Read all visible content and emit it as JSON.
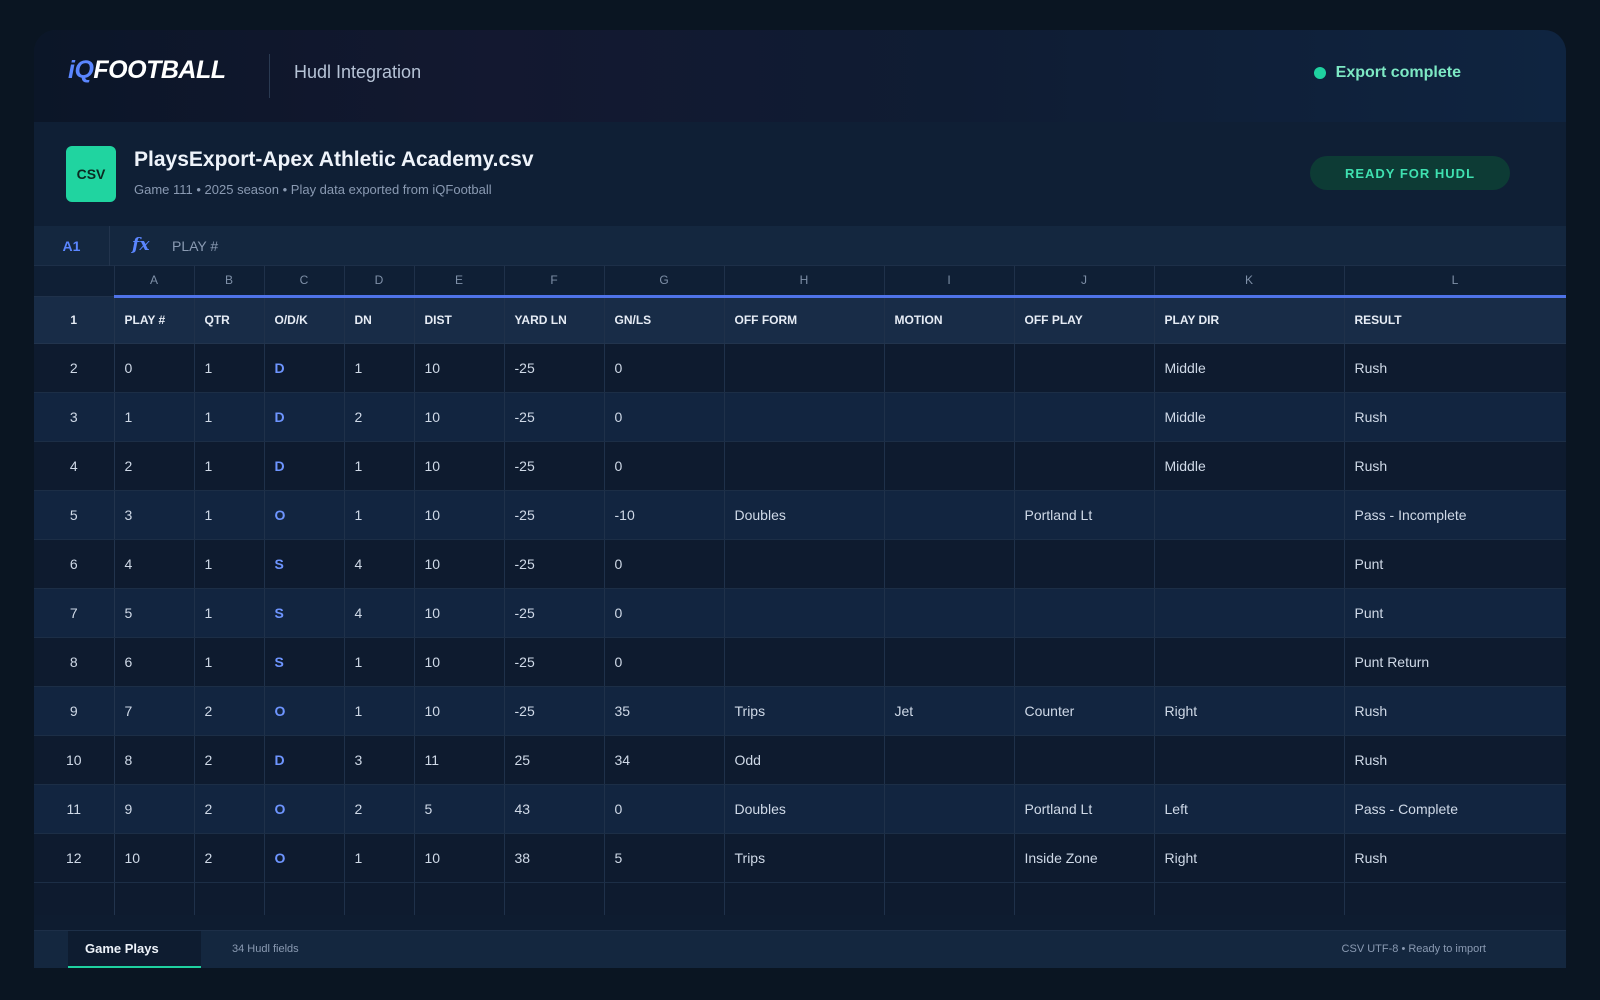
{
  "brand": {
    "logo_prefix": "iQ",
    "logo_suffix": "FOOTBALL",
    "app_title": "Hudl Integration"
  },
  "status": {
    "text": "Export complete",
    "color": "#1fd1a0"
  },
  "file": {
    "badge": "CSV",
    "name": "PlaysExport-Apex Athletic Academy.csv",
    "subtitle": "Game 111 • 2025 season • Play data exported from iQFootball",
    "action_label": "READY FOR HUDL"
  },
  "formula_bar": {
    "cell_ref": "A1",
    "fx_icon": "fx",
    "value": "PLAY #"
  },
  "columns": [
    "A",
    "B",
    "C",
    "D",
    "E",
    "F",
    "G",
    "H",
    "I",
    "J",
    "K",
    "L"
  ],
  "header_row": {
    "num": "1",
    "cells": [
      "PLAY #",
      "QTR",
      "O/D/K",
      "DN",
      "DIST",
      "YARD LN",
      "GN/LS",
      "OFF FORM",
      "MOTION",
      "OFF PLAY",
      "PLAY DIR",
      "RESULT"
    ]
  },
  "rows": [
    {
      "num": "2",
      "cells": [
        "0",
        "1",
        "D",
        "1",
        "10",
        "-25",
        "0",
        "",
        "",
        "",
        "Middle",
        "Rush"
      ]
    },
    {
      "num": "3",
      "cells": [
        "1",
        "1",
        "D",
        "2",
        "10",
        "-25",
        "0",
        "",
        "",
        "",
        "Middle",
        "Rush"
      ]
    },
    {
      "num": "4",
      "cells": [
        "2",
        "1",
        "D",
        "1",
        "10",
        "-25",
        "0",
        "",
        "",
        "",
        "Middle",
        "Rush"
      ]
    },
    {
      "num": "5",
      "cells": [
        "3",
        "1",
        "O",
        "1",
        "10",
        "-25",
        "-10",
        "Doubles",
        "",
        "Portland Lt",
        "",
        "Pass - Incomplete"
      ]
    },
    {
      "num": "6",
      "cells": [
        "4",
        "1",
        "S",
        "4",
        "10",
        "-25",
        "0",
        "",
        "",
        "",
        "",
        "Punt"
      ]
    },
    {
      "num": "7",
      "cells": [
        "5",
        "1",
        "S",
        "4",
        "10",
        "-25",
        "0",
        "",
        "",
        "",
        "",
        "Punt"
      ]
    },
    {
      "num": "8",
      "cells": [
        "6",
        "1",
        "S",
        "1",
        "10",
        "-25",
        "0",
        "",
        "",
        "",
        "",
        "Punt Return"
      ]
    },
    {
      "num": "9",
      "cells": [
        "7",
        "2",
        "O",
        "1",
        "10",
        "-25",
        "35",
        "Trips",
        "Jet",
        "Counter",
        "Right",
        "Rush"
      ]
    },
    {
      "num": "10",
      "cells": [
        "8",
        "2",
        "D",
        "3",
        "11",
        "25",
        "34",
        "Odd",
        "",
        "",
        "",
        "Rush"
      ]
    },
    {
      "num": "11",
      "cells": [
        "9",
        "2",
        "O",
        "2",
        "5",
        "43",
        "0",
        "Doubles",
        "",
        "Portland Lt",
        "Left",
        "Pass - Complete"
      ]
    },
    {
      "num": "12",
      "cells": [
        "10",
        "2",
        "O",
        "1",
        "10",
        "38",
        "5",
        "Trips",
        "",
        "Inside Zone",
        "Right",
        "Rush"
      ]
    }
  ],
  "footer": {
    "active_tab": "Game Plays",
    "fields_count": "34 Hudl fields",
    "encoding": "CSV UTF-8 • Ready to import"
  },
  "colors": {
    "accent": "#5b86ff",
    "success": "#1fd1a0",
    "background": "#0a1522"
  }
}
